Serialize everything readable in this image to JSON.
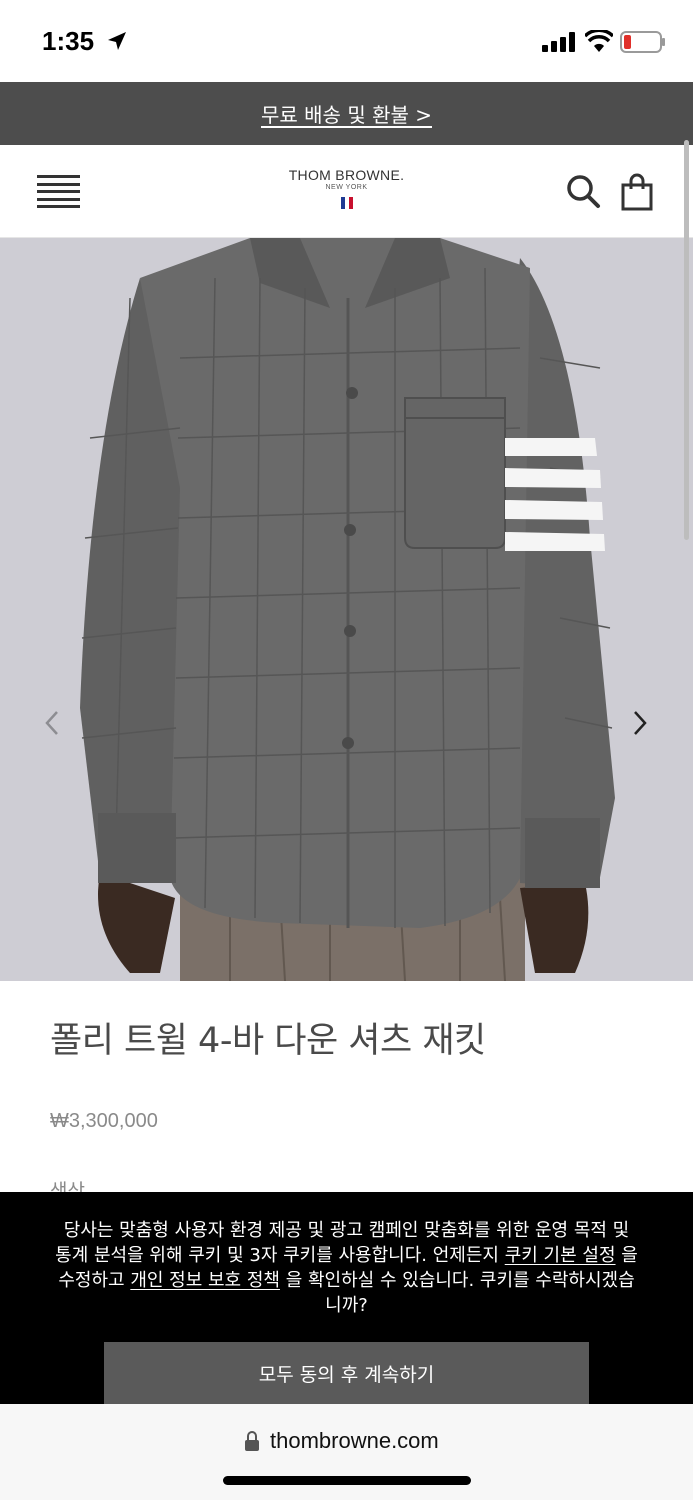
{
  "status_bar": {
    "time": "1:35"
  },
  "promo": {
    "label": "무료 배송 및 환불 >"
  },
  "header": {
    "logo_main": "THOM BROWNE.",
    "logo_sub": "NEW YORK",
    "flag_colors": [
      "#1f3a93",
      "#ffffff",
      "#c8102e"
    ]
  },
  "product": {
    "name": "폴리 트윌 4-바 다운 셔츠 재킷",
    "price": "₩3,300,000",
    "color_label": "색상"
  },
  "cookie": {
    "text_1": "당사는 맞춤형 사용자 환경 제공 및 광고 캠페인 맞춤화를 위한 운영 목적 및 통계 분석을 위해 쿠키 및 3자 쿠키를 사용합니다. 언제든지",
    "link_settings": "쿠키 기본 설정",
    "text_2": "을 수정하고",
    "link_privacy": "개인 정보 보호 정책",
    "text_3": "을 확인하실 수 있습니다. 쿠키를 수락하시겠습니까?",
    "accept_label": "모두 동의 후 계속하기"
  },
  "browser": {
    "url": "thombrowne.com"
  },
  "colors": {
    "banner_bg": "#4d4d4d",
    "image_bg": "#cecdd4",
    "cookie_bg": "#000000",
    "button_bg": "#5a5a5a"
  }
}
